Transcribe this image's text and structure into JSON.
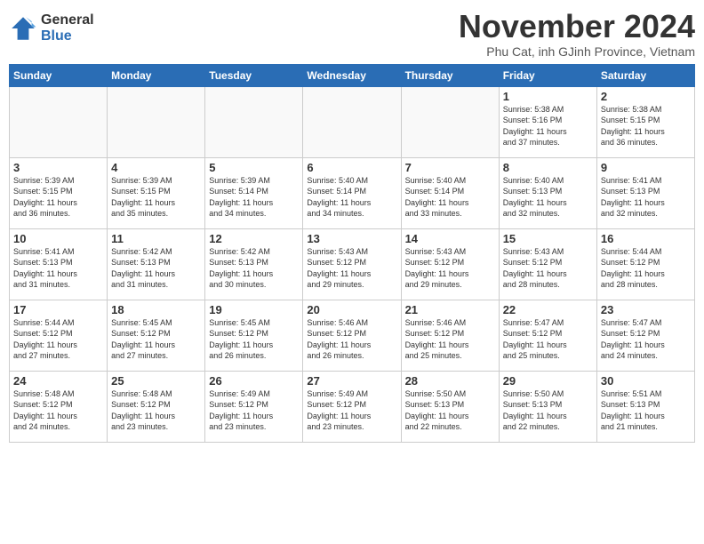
{
  "logo": {
    "general": "General",
    "blue": "Blue"
  },
  "title": "November 2024",
  "subtitle": "Phu Cat, inh GJinh Province, Vietnam",
  "headers": [
    "Sunday",
    "Monday",
    "Tuesday",
    "Wednesday",
    "Thursday",
    "Friday",
    "Saturday"
  ],
  "weeks": [
    [
      {
        "day": "",
        "info": ""
      },
      {
        "day": "",
        "info": ""
      },
      {
        "day": "",
        "info": ""
      },
      {
        "day": "",
        "info": ""
      },
      {
        "day": "",
        "info": ""
      },
      {
        "day": "1",
        "info": "Sunrise: 5:38 AM\nSunset: 5:16 PM\nDaylight: 11 hours\nand 37 minutes."
      },
      {
        "day": "2",
        "info": "Sunrise: 5:38 AM\nSunset: 5:15 PM\nDaylight: 11 hours\nand 36 minutes."
      }
    ],
    [
      {
        "day": "3",
        "info": "Sunrise: 5:39 AM\nSunset: 5:15 PM\nDaylight: 11 hours\nand 36 minutes."
      },
      {
        "day": "4",
        "info": "Sunrise: 5:39 AM\nSunset: 5:15 PM\nDaylight: 11 hours\nand 35 minutes."
      },
      {
        "day": "5",
        "info": "Sunrise: 5:39 AM\nSunset: 5:14 PM\nDaylight: 11 hours\nand 34 minutes."
      },
      {
        "day": "6",
        "info": "Sunrise: 5:40 AM\nSunset: 5:14 PM\nDaylight: 11 hours\nand 34 minutes."
      },
      {
        "day": "7",
        "info": "Sunrise: 5:40 AM\nSunset: 5:14 PM\nDaylight: 11 hours\nand 33 minutes."
      },
      {
        "day": "8",
        "info": "Sunrise: 5:40 AM\nSunset: 5:13 PM\nDaylight: 11 hours\nand 32 minutes."
      },
      {
        "day": "9",
        "info": "Sunrise: 5:41 AM\nSunset: 5:13 PM\nDaylight: 11 hours\nand 32 minutes."
      }
    ],
    [
      {
        "day": "10",
        "info": "Sunrise: 5:41 AM\nSunset: 5:13 PM\nDaylight: 11 hours\nand 31 minutes."
      },
      {
        "day": "11",
        "info": "Sunrise: 5:42 AM\nSunset: 5:13 PM\nDaylight: 11 hours\nand 31 minutes."
      },
      {
        "day": "12",
        "info": "Sunrise: 5:42 AM\nSunset: 5:13 PM\nDaylight: 11 hours\nand 30 minutes."
      },
      {
        "day": "13",
        "info": "Sunrise: 5:43 AM\nSunset: 5:12 PM\nDaylight: 11 hours\nand 29 minutes."
      },
      {
        "day": "14",
        "info": "Sunrise: 5:43 AM\nSunset: 5:12 PM\nDaylight: 11 hours\nand 29 minutes."
      },
      {
        "day": "15",
        "info": "Sunrise: 5:43 AM\nSunset: 5:12 PM\nDaylight: 11 hours\nand 28 minutes."
      },
      {
        "day": "16",
        "info": "Sunrise: 5:44 AM\nSunset: 5:12 PM\nDaylight: 11 hours\nand 28 minutes."
      }
    ],
    [
      {
        "day": "17",
        "info": "Sunrise: 5:44 AM\nSunset: 5:12 PM\nDaylight: 11 hours\nand 27 minutes."
      },
      {
        "day": "18",
        "info": "Sunrise: 5:45 AM\nSunset: 5:12 PM\nDaylight: 11 hours\nand 27 minutes."
      },
      {
        "day": "19",
        "info": "Sunrise: 5:45 AM\nSunset: 5:12 PM\nDaylight: 11 hours\nand 26 minutes."
      },
      {
        "day": "20",
        "info": "Sunrise: 5:46 AM\nSunset: 5:12 PM\nDaylight: 11 hours\nand 26 minutes."
      },
      {
        "day": "21",
        "info": "Sunrise: 5:46 AM\nSunset: 5:12 PM\nDaylight: 11 hours\nand 25 minutes."
      },
      {
        "day": "22",
        "info": "Sunrise: 5:47 AM\nSunset: 5:12 PM\nDaylight: 11 hours\nand 25 minutes."
      },
      {
        "day": "23",
        "info": "Sunrise: 5:47 AM\nSunset: 5:12 PM\nDaylight: 11 hours\nand 24 minutes."
      }
    ],
    [
      {
        "day": "24",
        "info": "Sunrise: 5:48 AM\nSunset: 5:12 PM\nDaylight: 11 hours\nand 24 minutes."
      },
      {
        "day": "25",
        "info": "Sunrise: 5:48 AM\nSunset: 5:12 PM\nDaylight: 11 hours\nand 23 minutes."
      },
      {
        "day": "26",
        "info": "Sunrise: 5:49 AM\nSunset: 5:12 PM\nDaylight: 11 hours\nand 23 minutes."
      },
      {
        "day": "27",
        "info": "Sunrise: 5:49 AM\nSunset: 5:12 PM\nDaylight: 11 hours\nand 23 minutes."
      },
      {
        "day": "28",
        "info": "Sunrise: 5:50 AM\nSunset: 5:13 PM\nDaylight: 11 hours\nand 22 minutes."
      },
      {
        "day": "29",
        "info": "Sunrise: 5:50 AM\nSunset: 5:13 PM\nDaylight: 11 hours\nand 22 minutes."
      },
      {
        "day": "30",
        "info": "Sunrise: 5:51 AM\nSunset: 5:13 PM\nDaylight: 11 hours\nand 21 minutes."
      }
    ]
  ]
}
